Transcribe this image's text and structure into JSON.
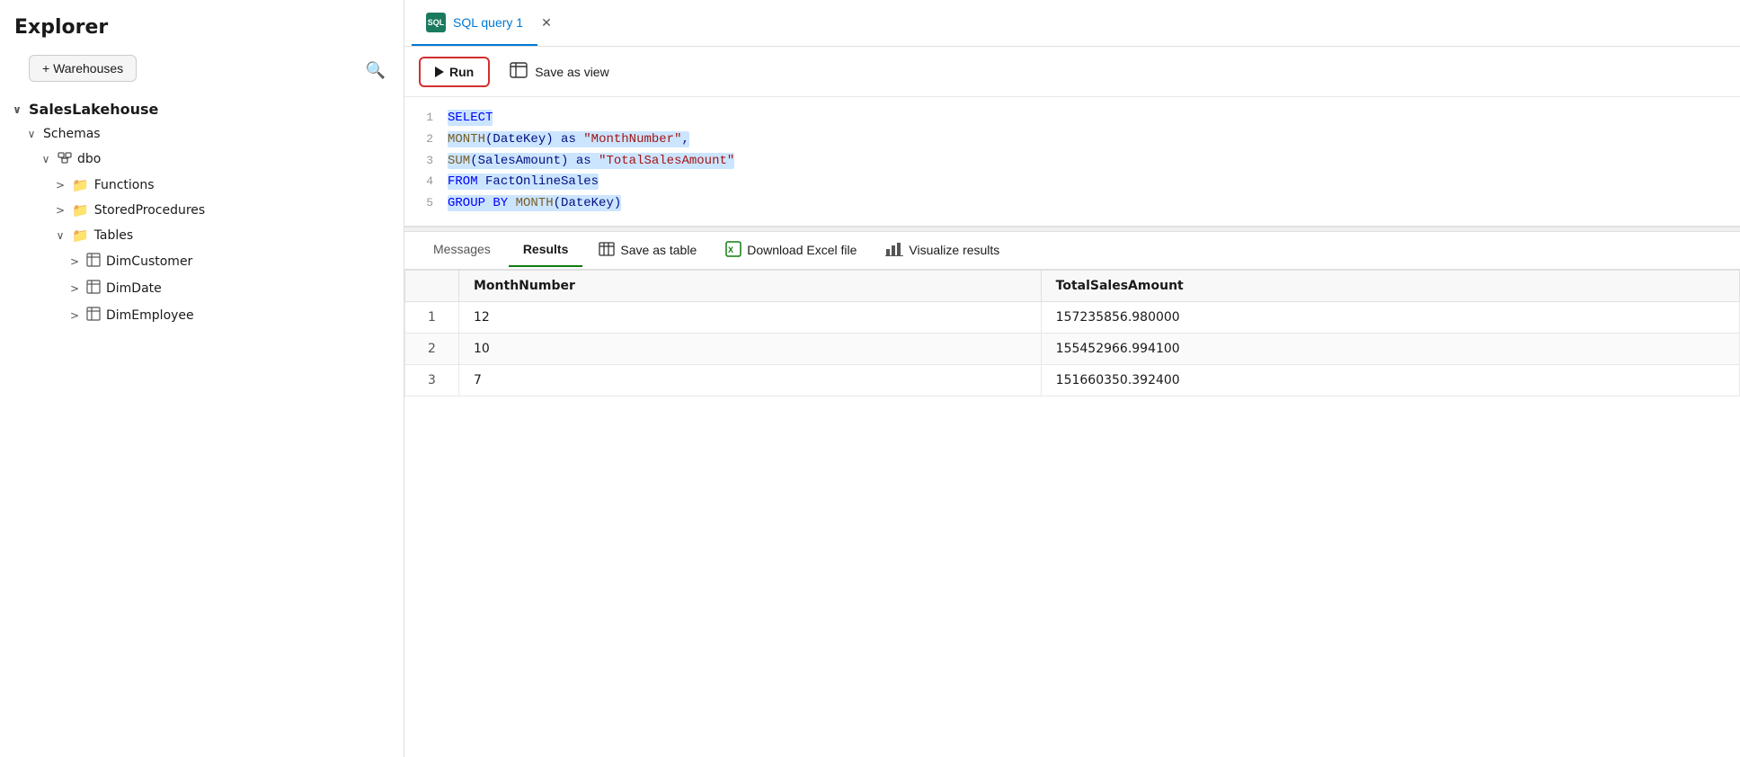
{
  "sidebar": {
    "header": "Explorer",
    "warehouses_btn": "+ Warehouses",
    "tree": [
      {
        "level": 0,
        "caret": "∨",
        "icon": "",
        "label": "SalesLakehouse"
      },
      {
        "level": 1,
        "caret": "∨",
        "icon": "",
        "label": "Schemas"
      },
      {
        "level": 2,
        "caret": "∨",
        "icon": "🗂",
        "label": "dbo"
      },
      {
        "level": 3,
        "caret": ">",
        "icon": "📁",
        "label": "Functions"
      },
      {
        "level": 3,
        "caret": ">",
        "icon": "📁",
        "label": "StoredProcedures"
      },
      {
        "level": 3,
        "caret": "∨",
        "icon": "📁",
        "label": "Tables"
      },
      {
        "level": 4,
        "caret": ">",
        "icon": "⊞",
        "label": "DimCustomer"
      },
      {
        "level": 4,
        "caret": ">",
        "icon": "⊞",
        "label": "DimDate"
      },
      {
        "level": 4,
        "caret": ">",
        "icon": "⊞",
        "label": "DimEmployee"
      }
    ]
  },
  "tab": {
    "label": "SQL query 1"
  },
  "toolbar": {
    "run_label": "Run",
    "save_view_label": "Save as view"
  },
  "code": {
    "lines": [
      {
        "num": 1,
        "content": "SELECT"
      },
      {
        "num": 2,
        "content": "MONTH(DateKey) as \"MonthNumber\","
      },
      {
        "num": 3,
        "content": "SUM(SalesAmount) as \"TotalSalesAmount\""
      },
      {
        "num": 4,
        "content": "FROM FactOnlineSales"
      },
      {
        "num": 5,
        "content": "GROUP BY MONTH(DateKey)"
      }
    ]
  },
  "results": {
    "tabs": [
      "Messages",
      "Results",
      "Save as table",
      "Download Excel file",
      "Visualize results"
    ],
    "active_tab": "Results",
    "columns": [
      "",
      "MonthNumber",
      "TotalSalesAmount"
    ],
    "rows": [
      {
        "idx": 1,
        "month": "12",
        "total": "157235856.980000"
      },
      {
        "idx": 2,
        "month": "10",
        "total": "155452966.994100"
      },
      {
        "idx": 3,
        "month": "7",
        "total": "151660350.392400"
      }
    ]
  }
}
